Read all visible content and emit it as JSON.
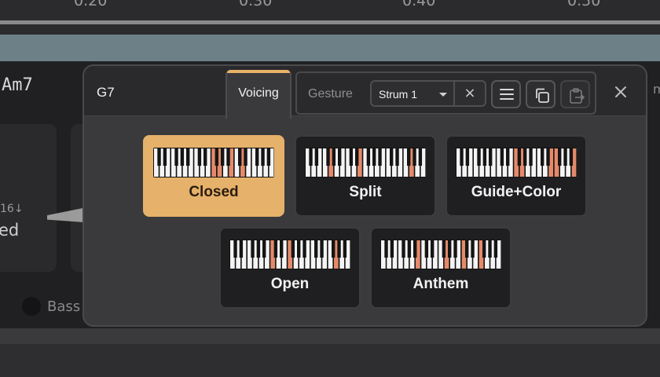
{
  "background": {
    "timeline_ticks": [
      "0.20",
      "0.30",
      "0.40",
      "0.50"
    ],
    "chord_label": "Am7",
    "card_number": "16↓",
    "card_word": "ed",
    "bass_label": "Bass",
    "right_hint": "m"
  },
  "popup": {
    "title": "G7",
    "tab_voicing": "Voicing",
    "gesture_label": "Gesture",
    "strum_value": "Strum 1",
    "clear_glyph": "×",
    "close_glyph": "×",
    "icons": [
      "menu-icon",
      "copy-icon",
      "paste-icon",
      "close-icon"
    ]
  },
  "voicings": [
    {
      "label": "Closed",
      "selected": true,
      "keys": 21,
      "highlight": [
        10,
        11,
        13,
        15
      ]
    },
    {
      "label": "Split",
      "selected": false,
      "keys": 21,
      "highlight": [
        4,
        9,
        18
      ]
    },
    {
      "label": "Guide+Color",
      "selected": false,
      "keys": 21,
      "highlight": [
        10,
        11,
        16,
        17,
        20
      ]
    },
    {
      "label": "Open",
      "selected": false,
      "keys": 21,
      "highlight": [
        7,
        10,
        18
      ]
    },
    {
      "label": "Anthem",
      "selected": false,
      "keys": 21,
      "highlight": [
        6,
        11,
        14,
        17
      ]
    }
  ],
  "colors": {
    "accent": "#e6b16a",
    "highlight_key": "#e48a6a",
    "card_bg": "#1f1f21",
    "popup_bg": "#3a3a3c"
  }
}
